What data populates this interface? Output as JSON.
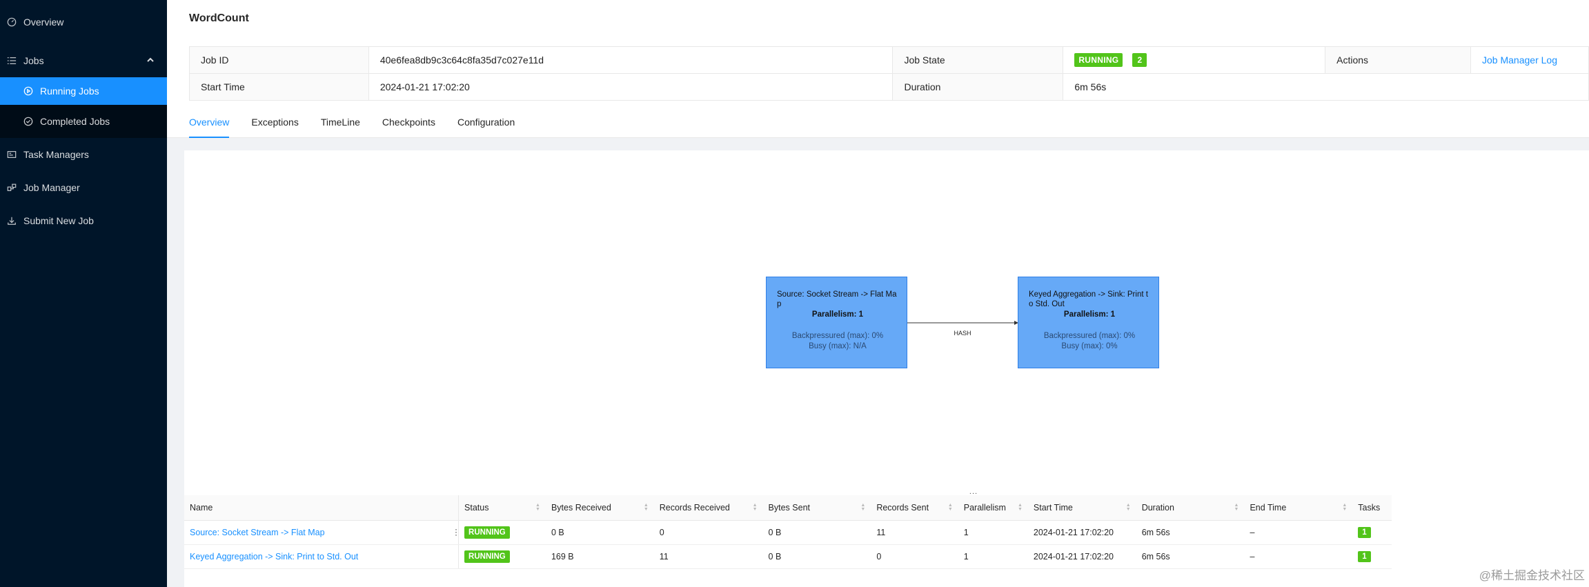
{
  "sidebar": {
    "overview": "Overview",
    "jobs": "Jobs",
    "running_jobs": "Running Jobs",
    "completed_jobs": "Completed Jobs",
    "task_managers": "Task Managers",
    "job_manager": "Job Manager",
    "submit_new_job": "Submit New Job"
  },
  "header": {
    "title": "WordCount",
    "job_id_label": "Job ID",
    "job_id": "40e6fea8db9c3c64c8fa35d7c027e11d",
    "job_state_label": "Job State",
    "job_state": "RUNNING",
    "job_state_count": "2",
    "actions_label": "Actions",
    "job_manager_log": "Job Manager Log",
    "start_time_label": "Start Time",
    "start_time": "2024-01-21 17:02:20",
    "duration_label": "Duration",
    "duration": "6m 56s"
  },
  "tabs": [
    "Overview",
    "Exceptions",
    "TimeLine",
    "Checkpoints",
    "Configuration"
  ],
  "graph": {
    "nodes": [
      {
        "title": "Source: Socket Stream -> Flat Map",
        "parallelism": "Parallelism: 1",
        "backpressured": "Backpressured (max): 0%",
        "busy": "Busy (max): N/A"
      },
      {
        "title": "Keyed Aggregation -> Sink: Print to Std. Out",
        "parallelism": "Parallelism: 1",
        "backpressured": "Backpressured (max): 0%",
        "busy": "Busy (max): 0%"
      }
    ],
    "edge_label": "HASH"
  },
  "vertex_table": {
    "handle": "...",
    "columns": [
      "Name",
      "Status",
      "Bytes Received",
      "Records Received",
      "Bytes Sent",
      "Records Sent",
      "Parallelism",
      "Start Time",
      "Duration",
      "End Time",
      "Tasks"
    ],
    "rows": [
      {
        "name": "Source: Socket Stream -> Flat Map",
        "status": "RUNNING",
        "bytes_received": "0 B",
        "records_received": "0",
        "bytes_sent": "0 B",
        "records_sent": "11",
        "parallelism": "1",
        "start_time": "2024-01-21 17:02:20",
        "duration": "6m 56s",
        "end_time": "–",
        "tasks": "1"
      },
      {
        "name": "Keyed Aggregation -> Sink: Print to Std. Out",
        "status": "RUNNING",
        "bytes_received": "169 B",
        "records_received": "11",
        "bytes_sent": "0 B",
        "records_sent": "0",
        "parallelism": "1",
        "start_time": "2024-01-21 17:02:20",
        "duration": "6m 56s",
        "end_time": "–",
        "tasks": "1"
      }
    ]
  },
  "watermark": "@稀土掘金技术社区",
  "colors": {
    "sidebar_bg": "#001529",
    "accent": "#1890ff",
    "running": "#52c41a",
    "node_fill": "#66a9f7"
  }
}
